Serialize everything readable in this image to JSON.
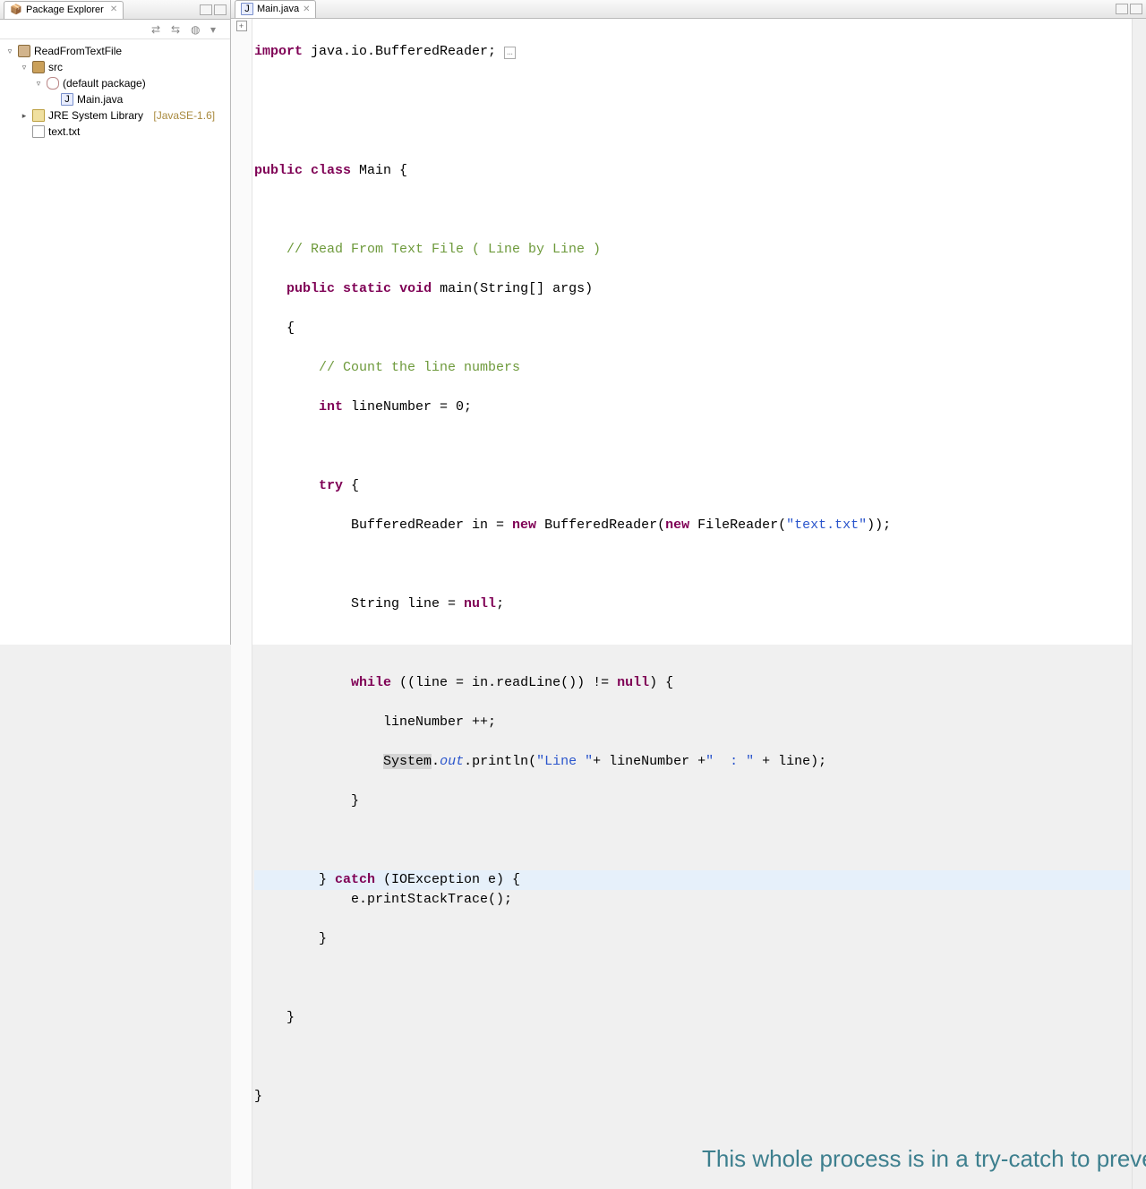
{
  "sidebar": {
    "title": "Package Explorer",
    "toolbar_icons": [
      "collapse-all-icon",
      "link-editor-icon",
      "view-menu-icon",
      "menu-dropdown-icon"
    ],
    "tree": {
      "project": "ReadFromTextFile",
      "src": "src",
      "pkg": "(default package)",
      "file": "Main.java",
      "lib": "JRE System Library",
      "lib_suffix": "[JavaSE-1.6]",
      "txt": "text.txt"
    }
  },
  "editor": {
    "tab": "Main.java",
    "code": {
      "l1a": "import",
      "l1b": " java.io.BufferedReader;",
      "l3a": "public",
      "l3b": " ",
      "l3c": "class",
      "l3d": " Main {",
      "l5": "    // Read From Text File ( Line by Line )",
      "l6a": "    ",
      "l6b": "public",
      "l6c": " ",
      "l6d": "static",
      "l6e": " ",
      "l6f": "void",
      "l6g": " main(String[] args)",
      "l7": "    {",
      "l8": "        // Count the line numbers",
      "l9a": "        ",
      "l9b": "int",
      "l9c": " lineNumber = 0;",
      "l11a": "        ",
      "l11b": "try",
      "l11c": " {",
      "l12a": "            BufferedReader in = ",
      "l12b": "new",
      "l12c": " BufferedReader(",
      "l12d": "new",
      "l12e": " FileReader(",
      "l12f": "\"text.txt\"",
      "l12g": "));",
      "l14a": "            String line = ",
      "l14b": "null",
      "l14c": ";",
      "l16a": "            ",
      "l16b": "while",
      "l16c": " ((line = in.readLine()) != ",
      "l16d": "null",
      "l16e": ") {",
      "l17": "                lineNumber ++;",
      "l18a": "                ",
      "l18b": "System",
      "l18c": ".",
      "l18d": "out",
      "l18e": ".println(",
      "l18f": "\"Line \"",
      "l18g": "+ lineNumber +",
      "l18h": "\"  : \"",
      "l18i": " + line);",
      "l19": "            }",
      "l21a": "        } ",
      "l21b": "catch",
      "l21c": " (IOException e) {",
      "l22": "            e.printStackTrace();",
      "l23": "        }",
      "l25": "    }",
      "l27": "}"
    }
  },
  "annotation": "This whole process is in a try-catch to prevent crashes if for example the file dont exists ore there is an error while reading"
}
